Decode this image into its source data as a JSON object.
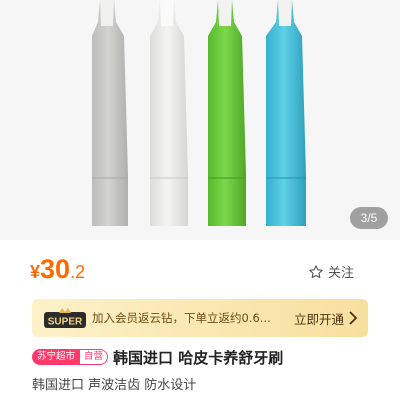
{
  "gallery": {
    "pager": "3/5",
    "colors": [
      "#cfcfcb",
      "#e9e9e7",
      "#6fcf3f",
      "#4fc3dd"
    ]
  },
  "price": {
    "currency": "¥",
    "integer": "30",
    "decimal": ".2"
  },
  "follow": {
    "icon": "star-outline-icon",
    "label": "关注"
  },
  "member_banner": {
    "badge": "SUPER",
    "text": "加入会员返云钻，下单立返约0.6...",
    "cta": "立即开通",
    "accent": "#ff6a00"
  },
  "product": {
    "tag_store": "苏宁超市",
    "tag_self": "自营",
    "title": "韩国进口 哈皮卡养舒牙刷",
    "subtitle": "韩国进口 声波洁齿 防水设计"
  }
}
